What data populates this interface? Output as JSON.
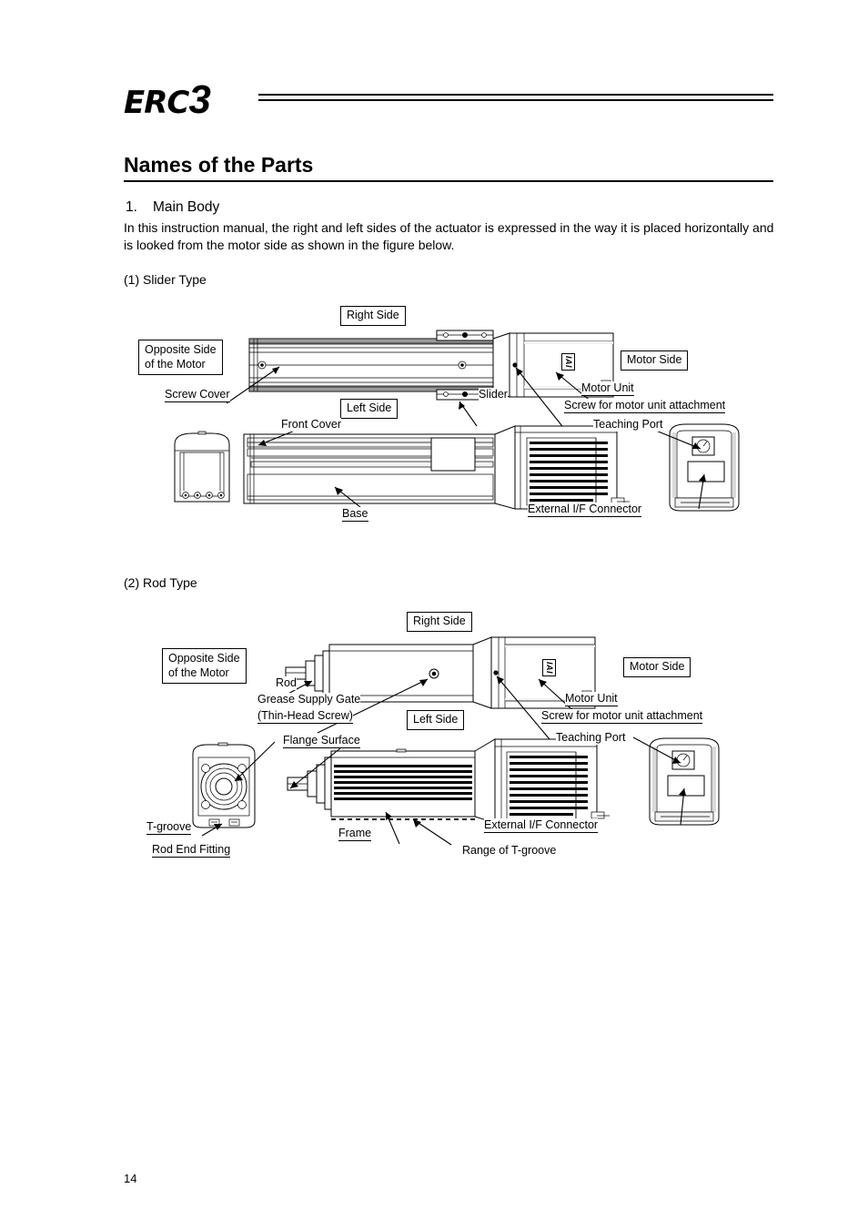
{
  "header": {
    "logo_main": "ERC",
    "logo_numeral": "3"
  },
  "title": "Names of the Parts",
  "section": {
    "number": "1.",
    "heading": "Main Body",
    "paragraph": "In this instruction manual, the right and left sides of the actuator is expressed in the way it is placed horizontally and is looked from the motor side as shown in the figure below."
  },
  "figures": [
    {
      "caption": "(1) Slider Type",
      "labels": {
        "right_side": "Right Side",
        "left_side": "Left Side",
        "opposite_side": "Opposite Side\nof the Motor",
        "opposite_side_l1": "Opposite Side",
        "opposite_side_l2": "of the Motor",
        "motor_side": "Motor Side",
        "screw_cover": "Screw Cover",
        "slider": "Slider",
        "motor_unit": "Motor Unit",
        "screw_attachment": "Screw for motor unit attachment",
        "front_cover": "Front Cover",
        "base": "Base",
        "teaching_port": "Teaching Port",
        "external_if": "External I/F Connector",
        "iai_badge": "IAI"
      }
    },
    {
      "caption": "(2) Rod Type",
      "labels": {
        "right_side": "Right Side",
        "left_side": "Left Side",
        "opposite_side_l1": "Opposite Side",
        "opposite_side_l2": "of the Motor",
        "motor_side": "Motor Side",
        "rod": "Rod",
        "grease_l1": "Grease Supply Gate",
        "grease_l2": "(Thin-Head Screw)",
        "motor_unit": "Motor Unit",
        "screw_attachment": "Screw for motor unit attachment",
        "flange_surface": "Flange Surface",
        "t_groove": "T-groove",
        "rod_end_fitting": "Rod End Fitting",
        "frame": "Frame",
        "range_t_groove": "Range of T-groove",
        "teaching_port": "Teaching Port",
        "external_if": "External I/F Connector",
        "iai_badge": "IAI"
      }
    }
  ],
  "footer": {
    "page_number": "14"
  },
  "colors": {
    "ink": "#000000",
    "paper": "#ffffff",
    "shade_light": "#f2f2f2",
    "shade_mid": "#d9d9d9",
    "shade_dark": "#9a9a9a"
  }
}
